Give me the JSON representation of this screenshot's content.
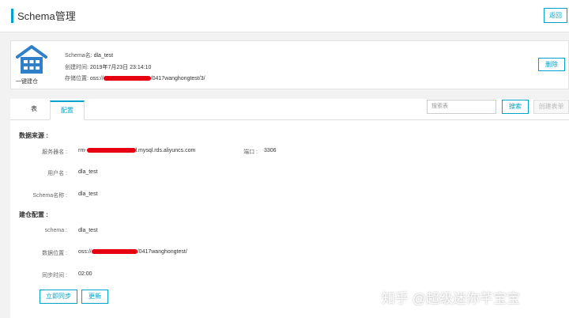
{
  "header": {
    "title": "Schema管理",
    "back_label": "返回"
  },
  "schema_card": {
    "logo_label": "一键建仓",
    "name_key": "Schema名:",
    "name_value": "dla_test",
    "created_key": "创建时间:",
    "created_value": "2019年7月23日 23:14:10",
    "location_key": "存储位置:",
    "location_prefix": "oss://",
    "location_suffix": "/0417wanghongtest/3/",
    "delete_label": "删除"
  },
  "tabs": [
    {
      "label": "表"
    },
    {
      "label": "配置"
    }
  ],
  "toolbar": {
    "search_placeholder": "搜索表",
    "search_label": "搜索",
    "create_label": "创建表单"
  },
  "data_source": {
    "section_title": "数据来源 :",
    "server_key": "服务器名 :",
    "server_prefix": "rm-",
    "server_suffix": "l.mysql.rds.aliyuncs.com",
    "port_key": "端口 :",
    "port_value": "3306",
    "user_key": "用户名 :",
    "user_value": "dla_test",
    "schema_key": "Schema名称 :",
    "schema_value": "dla_test"
  },
  "build_config": {
    "section_title": "建仓配置 :",
    "schema_key": "schema :",
    "schema_value": "dla_test",
    "location_key": "数据位置 :",
    "location_prefix": "oss://",
    "location_suffix": "/0417wanghongtest/",
    "sync_key": "同步时间 :",
    "sync_value": "02:00",
    "sync_now_label": "立即同步",
    "update_label": "更新"
  },
  "watermark": "知乎 @超级迷你芊宝宝",
  "colors": {
    "accent": "#00a2ca",
    "redaction": "#e60012",
    "logo": "#2f80c8"
  }
}
